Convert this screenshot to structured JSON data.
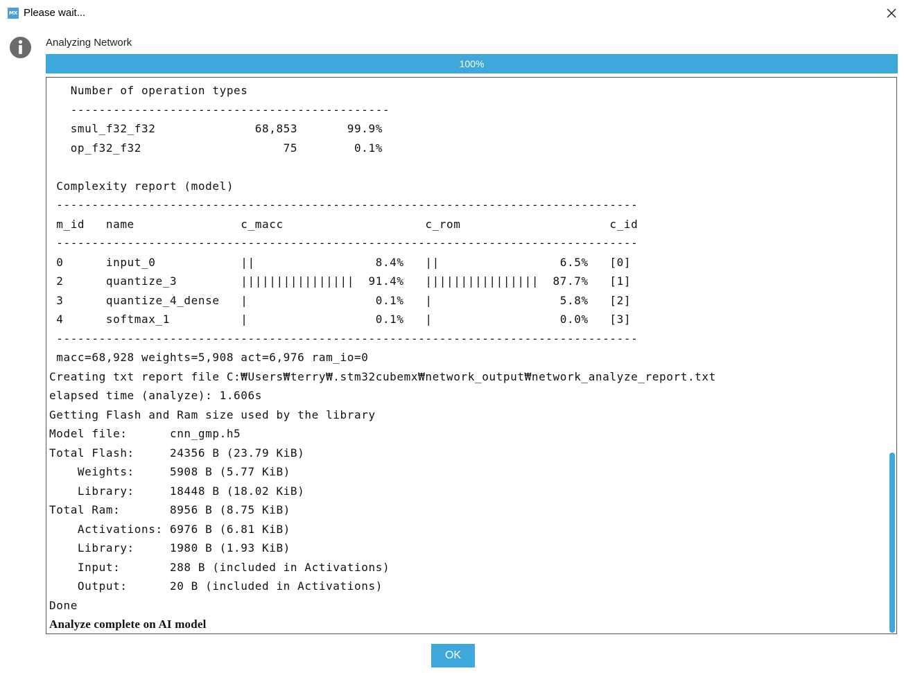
{
  "window": {
    "title": "Please wait...",
    "logo_text": "MX"
  },
  "dialog": {
    "status_label": "Analyzing Network",
    "progress_percent": 100,
    "progress_text": "100%",
    "ok_label": "OK"
  },
  "console": {
    "lines": [
      "   Number of operation types",
      "   ---------------------------------------------",
      "   smul_f32_f32              68,853       99.9%",
      "   op_f32_f32                    75        0.1%",
      "",
      " Complexity report (model)",
      " ----------------------------------------------------------------------------------",
      " m_id   name               c_macc                    c_rom                     c_id",
      " ----------------------------------------------------------------------------------",
      " 0      input_0            ||                 8.4%   ||                 6.5%   [0]",
      " 2      quantize_3         ||||||||||||||||  91.4%   ||||||||||||||||  87.7%   [1]",
      " 3      quantize_4_dense   |                  0.1%   |                  5.8%   [2]",
      " 4      softmax_1          |                  0.1%   |                  0.0%   [3]",
      " ----------------------------------------------------------------------------------",
      " macc=68,928 weights=5,908 act=6,976 ram_io=0",
      "Creating txt report file C:₩Users₩terry₩.stm32cubemx₩network_output₩network_analyze_report.txt",
      "elapsed time (analyze): 1.606s",
      "Getting Flash and Ram size used by the library",
      "Model file:      cnn_gmp.h5",
      "Total Flash:     24356 B (23.79 KiB)",
      "    Weights:     5908 B (5.77 KiB)",
      "    Library:     18448 B (18.02 KiB)",
      "Total Ram:       8956 B (8.75 KiB)",
      "    Activations: 6976 B (6.81 KiB)",
      "    Library:     1980 B (1.93 KiB)",
      "    Input:       288 B (included in Activations)",
      "    Output:      20 B (included in Activations)",
      "Done"
    ],
    "final_message": "Analyze complete on AI model"
  },
  "icons": {
    "logo": "app-logo-icon",
    "close": "close-icon",
    "info": "info-icon"
  },
  "colors": {
    "accent": "#3ea8dc",
    "info_icon": "#6b6b6b"
  }
}
